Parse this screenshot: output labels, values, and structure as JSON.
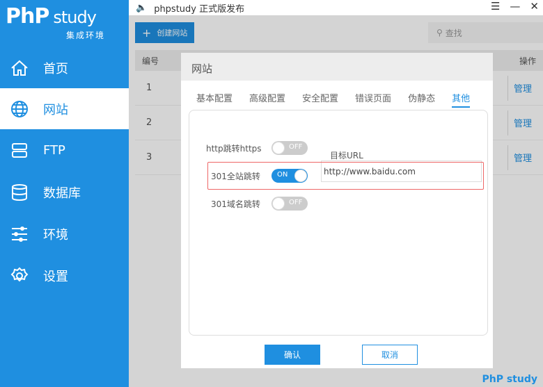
{
  "logo": {
    "text": "PhP",
    "suffix": "study",
    "sub": "集成环境"
  },
  "sidebar": {
    "items": [
      {
        "label": "首页"
      },
      {
        "label": "网站"
      },
      {
        "label": "FTP"
      },
      {
        "label": "数据库"
      },
      {
        "label": "环境"
      },
      {
        "label": "设置"
      }
    ]
  },
  "titlebar": {
    "title": "phpstudy 正式版发布"
  },
  "toolbar": {
    "create": "创建网站",
    "search": "查找"
  },
  "table": {
    "col_id": "编号",
    "col_action": "操作",
    "rows": [
      {
        "id": "1",
        "action": "管理"
      },
      {
        "id": "2",
        "action": "管理"
      },
      {
        "id": "3",
        "action": "管理"
      }
    ]
  },
  "dialog": {
    "title": "网站",
    "tabs": [
      "基本配置",
      "高级配置",
      "安全配置",
      "错误页面",
      "伪静态",
      "其他"
    ],
    "http_https": {
      "label": "http跳转https",
      "state": "OFF"
    },
    "site301": {
      "label": "301全站跳转",
      "state": "ON",
      "target_label": "目标URL",
      "target_value": "http://www.baidu.com"
    },
    "domain301": {
      "label": "301域名跳转",
      "state": "OFF"
    },
    "confirm": "确认",
    "cancel": "取消"
  },
  "footer": {
    "brand": "PhP study"
  }
}
